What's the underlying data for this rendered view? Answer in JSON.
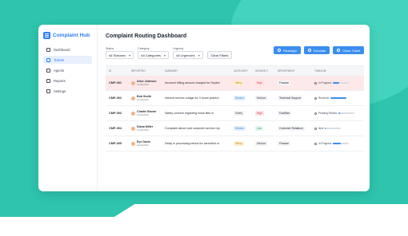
{
  "app": {
    "name": "Complaint Hub"
  },
  "sidebar": {
    "items": [
      {
        "label": "Dashboard",
        "icon": "dashboard-icon",
        "active": false
      },
      {
        "label": "Tickets",
        "icon": "tickets-icon",
        "active": true
      },
      {
        "label": "Agents",
        "icon": "agents-icon",
        "active": false
      },
      {
        "label": "Reports",
        "icon": "reports-icon",
        "active": false
      },
      {
        "label": "Settings",
        "icon": "settings-icon",
        "active": false
      }
    ]
  },
  "page": {
    "title": "Complaint Routing Dashboard"
  },
  "filters": {
    "status": {
      "label": "Status",
      "value": "All Statuses"
    },
    "category": {
      "label": "Category",
      "value": "All Categories"
    },
    "urgency": {
      "label": "Urgency",
      "value": "All Urgencies"
    },
    "clear_label": "Clear Filters"
  },
  "actions": {
    "reassign": "Reassign",
    "escalate": "Escalate",
    "close": "Close Ticket"
  },
  "table": {
    "headers": [
      "ID",
      "REPORTED",
      "SUMMARY",
      "CATEGORY",
      "URGENCY",
      "DEPARTMENT",
      "TIMELINE"
    ],
    "rows": [
      {
        "id": "CMP-001",
        "name": "Alice Johnson",
        "date": "11/25/2023",
        "summary": "Incorrect billing amount charged for Septen",
        "category": "Billing",
        "urgency": "High",
        "department": "Finance",
        "timeline": "In Progress",
        "progress": 0.4,
        "highlight": true
      },
      {
        "id": "CMP-002",
        "name": "Bob Smith",
        "date": "11/24/2023",
        "summary": "Internet service outage for 3 hours yesterd",
        "category": "Service",
        "urgency": "Medium",
        "department": "Technical Support",
        "timeline": "Resolved",
        "progress": 1.0,
        "highlight": false
      },
      {
        "id": "CMP-003",
        "name": "Charlie Brown",
        "date": "11/23/2023",
        "summary": "Safety concern regarding loose tiles in",
        "category": "Safety",
        "urgency": "High",
        "department": "Facilities",
        "timeline": "Pending Review",
        "progress": 0.1,
        "highlight": false
      },
      {
        "id": "CMP-004",
        "name": "Diana Miller",
        "date": "11/22/2023",
        "summary": "Complaint about rude customer service rep",
        "category": "Service",
        "urgency": "Low",
        "department": "Customer Relations",
        "timeline": "New",
        "progress": 0.05,
        "highlight": false
      },
      {
        "id": "CMP-005",
        "name": "Eve Davis",
        "date": "11/21/2023",
        "summary": "Delay in processing refund for cancelled or",
        "category": "Billing",
        "urgency": "Medium",
        "department": "Finance",
        "timeline": "In Progress",
        "progress": 0.5,
        "highlight": false
      }
    ]
  },
  "colors": {
    "accent": "#2f7df6",
    "background": "#2ec4ad",
    "highlight_row": "#fde8ea"
  }
}
